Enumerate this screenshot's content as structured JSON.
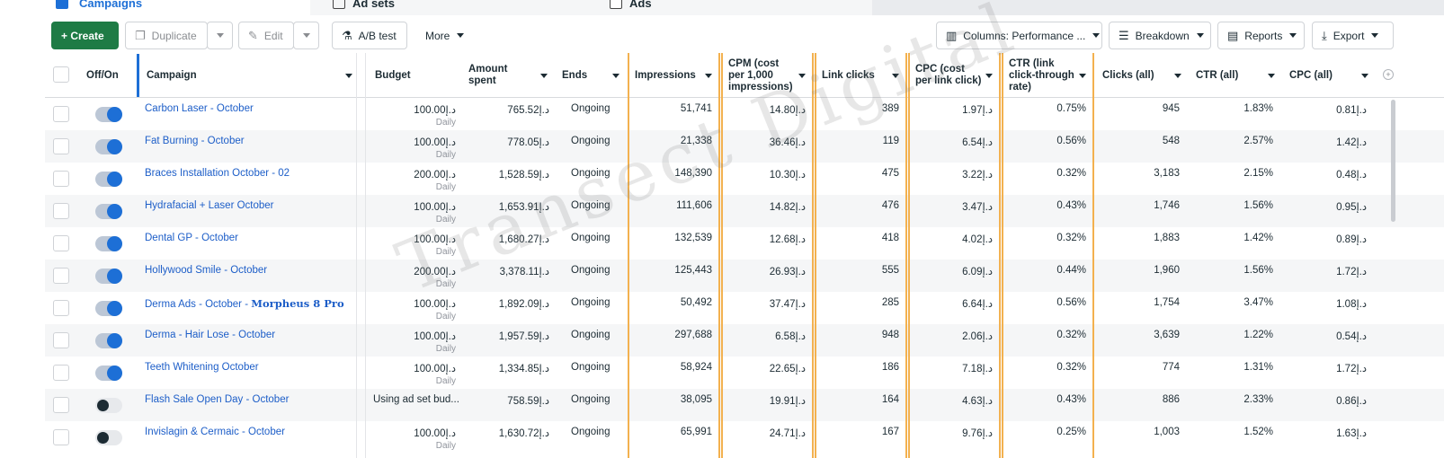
{
  "tabs": {
    "campaigns": "Campaigns",
    "ad_sets": "Ad sets",
    "ads": "Ads"
  },
  "toolbar": {
    "create": "+ Create",
    "duplicate": "Duplicate",
    "edit": "Edit",
    "ab_test": "A/B test",
    "more": "More",
    "columns": "Columns: Performance ...",
    "breakdown": "Breakdown",
    "reports": "Reports",
    "export": "Export"
  },
  "columns": {
    "off_on": "Off/On",
    "campaign": "Campaign",
    "budget": "Budget",
    "amount_spent": "Amount spent",
    "ends": "Ends",
    "impressions": "Impressions",
    "cpm": "CPM (cost per 1,000 impressions)",
    "link_clicks": "Link clicks",
    "cpc_link": "CPC (cost per link click)",
    "ctr_link": "CTR (link click-through rate)",
    "clicks_all": "Clicks (all)",
    "ctr_all": "CTR (all)",
    "cpc_all": "CPC (all)"
  },
  "watermark": "Transect Digital",
  "currency": "د.إ",
  "rows": [
    {
      "campaign": "Carbon Laser - October",
      "on": true,
      "budget": "د.إ100.00",
      "budget_sub": "Daily",
      "spent": "د.إ765.52",
      "ends": "Ongoing",
      "impressions": "51,741",
      "cpm": "د.إ14.80",
      "link_clicks": "389",
      "cpc_link": "د.إ1.97",
      "ctr_link": "0.75%",
      "clicks_all": "945",
      "ctr_all": "1.83%",
      "cpc_all": "د.إ0.81"
    },
    {
      "campaign": "Fat Burning - October",
      "on": true,
      "budget": "د.إ100.00",
      "budget_sub": "Daily",
      "spent": "د.إ778.05",
      "ends": "Ongoing",
      "impressions": "21,338",
      "cpm": "د.إ36.46",
      "link_clicks": "119",
      "cpc_link": "د.إ6.54",
      "ctr_link": "0.56%",
      "clicks_all": "548",
      "ctr_all": "2.57%",
      "cpc_all": "د.إ1.42"
    },
    {
      "campaign": "Braces Installation October - 02",
      "on": true,
      "budget": "د.إ200.00",
      "budget_sub": "Daily",
      "spent": "د.إ1,528.59",
      "ends": "Ongoing",
      "impressions": "148,390",
      "cpm": "د.إ10.30",
      "link_clicks": "475",
      "cpc_link": "د.إ3.22",
      "ctr_link": "0.32%",
      "clicks_all": "3,183",
      "ctr_all": "2.15%",
      "cpc_all": "د.إ0.48"
    },
    {
      "campaign": "Hydrafacial + Laser October",
      "on": true,
      "budget": "د.إ100.00",
      "budget_sub": "Daily",
      "spent": "د.إ1,653.91",
      "ends": "Ongoing",
      "impressions": "111,606",
      "cpm": "د.إ14.82",
      "link_clicks": "476",
      "cpc_link": "د.إ3.47",
      "ctr_link": "0.43%",
      "clicks_all": "1,746",
      "ctr_all": "1.56%",
      "cpc_all": "د.إ0.95"
    },
    {
      "campaign": "Dental GP - October",
      "on": true,
      "budget": "د.إ100.00",
      "budget_sub": "Daily",
      "spent": "د.إ1,680.27",
      "ends": "Ongoing",
      "impressions": "132,539",
      "cpm": "د.إ12.68",
      "link_clicks": "418",
      "cpc_link": "د.إ4.02",
      "ctr_link": "0.32%",
      "clicks_all": "1,883",
      "ctr_all": "1.42%",
      "cpc_all": "د.إ0.89"
    },
    {
      "campaign": "Hollywood Smile - October",
      "on": true,
      "budget": "د.إ200.00",
      "budget_sub": "Daily",
      "spent": "د.إ3,378.11",
      "ends": "Ongoing",
      "impressions": "125,443",
      "cpm": "د.إ26.93",
      "link_clicks": "555",
      "cpc_link": "د.إ6.09",
      "ctr_link": "0.44%",
      "clicks_all": "1,960",
      "ctr_all": "1.56%",
      "cpc_all": "د.إ1.72"
    },
    {
      "campaign": "Derma Ads - October - ",
      "campaign_bold": "Morpheus 8 Pro",
      "on": true,
      "budget": "د.إ100.00",
      "budget_sub": "Daily",
      "spent": "د.إ1,892.09",
      "ends": "Ongoing",
      "impressions": "50,492",
      "cpm": "د.إ37.47",
      "link_clicks": "285",
      "cpc_link": "د.إ6.64",
      "ctr_link": "0.56%",
      "clicks_all": "1,754",
      "ctr_all": "3.47%",
      "cpc_all": "د.إ1.08"
    },
    {
      "campaign": "Derma - Hair Lose - October",
      "on": true,
      "budget": "د.إ100.00",
      "budget_sub": "Daily",
      "spent": "د.إ1,957.59",
      "ends": "Ongoing",
      "impressions": "297,688",
      "cpm": "د.إ6.58",
      "link_clicks": "948",
      "cpc_link": "د.إ2.06",
      "ctr_link": "0.32%",
      "clicks_all": "3,639",
      "ctr_all": "1.22%",
      "cpc_all": "د.إ0.54"
    },
    {
      "campaign": "Teeth Whitening October",
      "on": true,
      "budget": "د.إ100.00",
      "budget_sub": "Daily",
      "spent": "د.إ1,334.85",
      "ends": "Ongoing",
      "impressions": "58,924",
      "cpm": "د.إ22.65",
      "link_clicks": "186",
      "cpc_link": "د.إ7.18",
      "ctr_link": "0.32%",
      "clicks_all": "774",
      "ctr_all": "1.31%",
      "cpc_all": "د.إ1.72"
    },
    {
      "campaign": "Flash Sale Open Day - October",
      "on": false,
      "budget": "Using ad set bud...",
      "budget_sub": "",
      "spent": "د.إ758.59",
      "ends": "Ongoing",
      "impressions": "38,095",
      "cpm": "د.إ19.91",
      "link_clicks": "164",
      "cpc_link": "د.إ4.63",
      "ctr_link": "0.43%",
      "clicks_all": "886",
      "ctr_all": "2.33%",
      "cpc_all": "د.إ0.86"
    },
    {
      "campaign": "Invislagin & Cermaic - October",
      "on": false,
      "budget": "د.إ100.00",
      "budget_sub": "Daily",
      "spent": "د.إ1,630.72",
      "ends": "Ongoing",
      "impressions": "65,991",
      "cpm": "د.إ24.71",
      "link_clicks": "167",
      "cpc_link": "د.إ9.76",
      "ctr_link": "0.25%",
      "clicks_all": "1,003",
      "ctr_all": "1.52%",
      "cpc_all": "د.إ1.63"
    }
  ]
}
